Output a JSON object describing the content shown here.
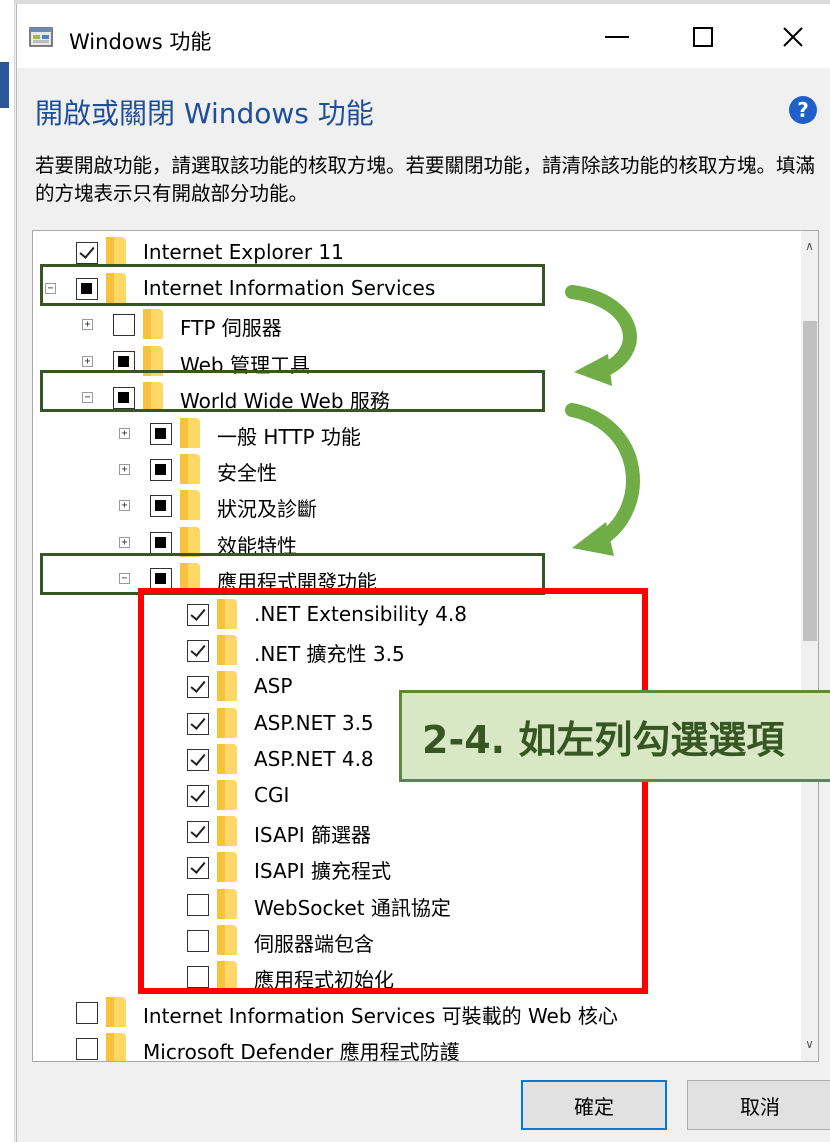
{
  "window": {
    "title": "Windows 功能",
    "minimize_label": "",
    "close_glyph": "✕"
  },
  "heading": "開啟或關閉 Windows 功能",
  "help_glyph": "?",
  "description": "若要開啟功能，請選取該功能的核取方塊。若要關閉功能，請清除該功能的核取方塊。填滿的方塊表示只有開啟部分功能。",
  "tree": [
    {
      "label": "Internet Explorer 11",
      "state": "checked",
      "expander": ""
    },
    {
      "label": "Internet Information Services",
      "state": "partial",
      "expander": "−"
    },
    {
      "label": "FTP 伺服器",
      "state": "unchecked",
      "expander": "+"
    },
    {
      "label": "Web 管理工具",
      "state": "partial",
      "expander": "+"
    },
    {
      "label": "World Wide Web 服務",
      "state": "partial",
      "expander": "−"
    },
    {
      "label": "一般 HTTP 功能",
      "state": "partial",
      "expander": "+"
    },
    {
      "label": "安全性",
      "state": "partial",
      "expander": "+"
    },
    {
      "label": "狀況及診斷",
      "state": "partial",
      "expander": "+"
    },
    {
      "label": "效能特性",
      "state": "partial",
      "expander": "+"
    },
    {
      "label": "應用程式開發功能",
      "state": "partial",
      "expander": "−"
    },
    {
      "label": ".NET Extensibility 4.8",
      "state": "checked",
      "expander": ""
    },
    {
      "label": ".NET 擴充性 3.5",
      "state": "checked",
      "expander": ""
    },
    {
      "label": "ASP",
      "state": "checked",
      "expander": ""
    },
    {
      "label": "ASP.NET 3.5",
      "state": "checked",
      "expander": ""
    },
    {
      "label": "ASP.NET 4.8",
      "state": "checked",
      "expander": ""
    },
    {
      "label": "CGI",
      "state": "checked",
      "expander": ""
    },
    {
      "label": "ISAPI 篩選器",
      "state": "checked",
      "expander": ""
    },
    {
      "label": "ISAPI 擴充程式",
      "state": "checked",
      "expander": ""
    },
    {
      "label": "WebSocket 通訊協定",
      "state": "unchecked",
      "expander": ""
    },
    {
      "label": "伺服器端包含",
      "state": "unchecked",
      "expander": ""
    },
    {
      "label": "應用程式初始化",
      "state": "unchecked",
      "expander": ""
    },
    {
      "label": "Internet Information Services 可裝載的 Web 核心",
      "state": "unchecked",
      "expander": ""
    },
    {
      "label": "Microsoft Defender 應用程式防護",
      "state": "unchecked",
      "expander": ""
    }
  ],
  "annotation": "2-4. 如左列勾選選項",
  "buttons": {
    "ok": "確定",
    "cancel": "取消"
  },
  "colors": {
    "heading": "#1f4e9b",
    "green": "#70ad47",
    "red": "#ff0000",
    "annotation_bg": "#d9e8c4"
  }
}
